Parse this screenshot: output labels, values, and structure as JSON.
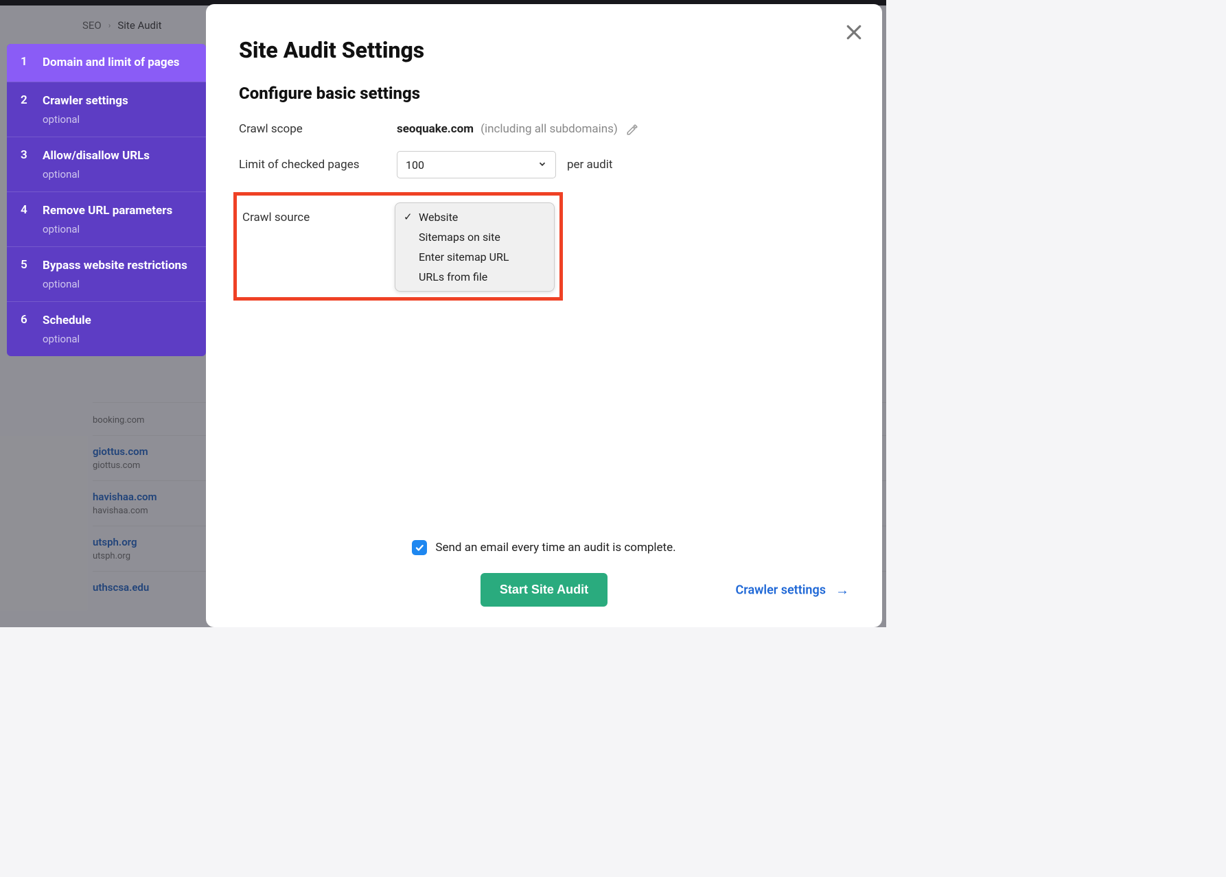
{
  "breadcrumb": {
    "crumb1": "SEO",
    "crumb2": "Site Audit"
  },
  "bg_list": [
    {
      "name": "booking.com",
      "sub": ""
    },
    {
      "name": "giottus.com",
      "sub": "giottus.com"
    },
    {
      "name": "havishaa.com",
      "sub": "havishaa.com"
    },
    {
      "name": "utsph.org",
      "sub": "utsph.org"
    },
    {
      "name": "uthscsa.edu",
      "sub": ""
    }
  ],
  "sidebar": {
    "steps": [
      {
        "num": "1",
        "title": "Domain and limit of pages",
        "optional": ""
      },
      {
        "num": "2",
        "title": "Crawler settings",
        "optional": "optional"
      },
      {
        "num": "3",
        "title": "Allow/disallow URLs",
        "optional": "optional"
      },
      {
        "num": "4",
        "title": "Remove URL parameters",
        "optional": "optional"
      },
      {
        "num": "5",
        "title": "Bypass website restrictions",
        "optional": "optional"
      },
      {
        "num": "6",
        "title": "Schedule",
        "optional": "optional"
      }
    ]
  },
  "modal": {
    "title": "Site Audit Settings",
    "subtitle": "Configure basic settings",
    "scope_label": "Crawl scope",
    "scope_value": "seoquake.com",
    "scope_note": "(including all subdomains)",
    "limit_label": "Limit of checked pages",
    "limit_value": "100",
    "per_audit": "per audit",
    "source_label": "Crawl source",
    "source_options": [
      "Website",
      "Sitemaps on site",
      "Enter sitemap URL",
      "URLs from file"
    ],
    "source_selected_index": 0,
    "email_label": "Send an email every time an audit is complete.",
    "primary_button": "Start Site Audit",
    "next_link": "Crawler settings"
  }
}
